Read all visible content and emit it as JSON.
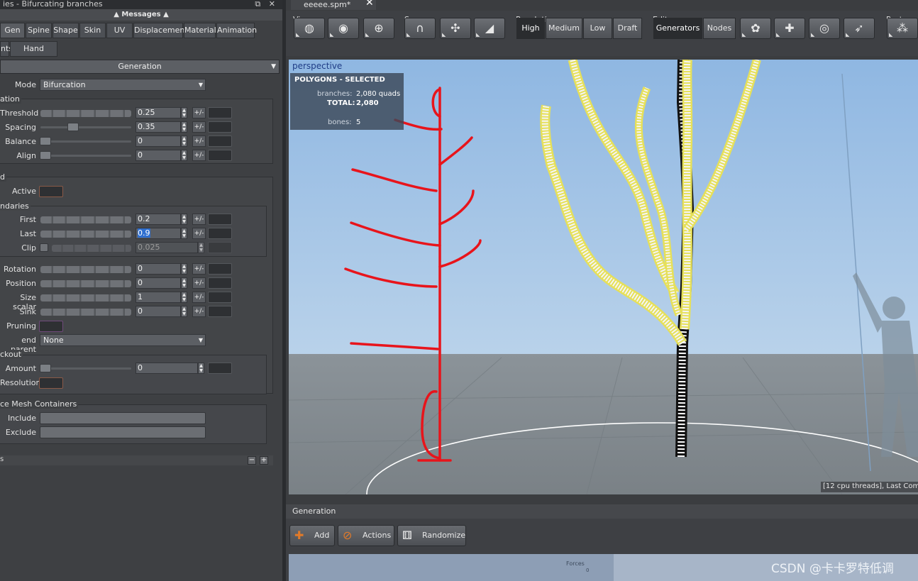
{
  "left_panel": {
    "title": "ies - Bifurcating branches",
    "title_buttons": "⧉ ✕",
    "messages": "▲ Messages ▲",
    "tabs": [
      "Gen",
      "Spine",
      "Shape",
      "Skin",
      "UV",
      "Displacement",
      "Material",
      "Animation"
    ],
    "tabs2": [
      "nts",
      "Hand Drawn"
    ],
    "section": "Generation",
    "mode_label": "Mode",
    "mode_value": "Bifurcation",
    "group1_label": "ation",
    "group2_label": "d",
    "group3_label": "ndaries",
    "group4_label": "ckout",
    "group5_label": "ce Mesh Containers",
    "rows": {
      "threshold": {
        "label": "Threshold",
        "value": "0.25"
      },
      "spacing": {
        "label": "Spacing",
        "value": "0.35",
        "level": 0.35
      },
      "balance": {
        "label": "Balance",
        "value": "0"
      },
      "align": {
        "label": "Align",
        "value": "0"
      },
      "active": {
        "label": "Active"
      },
      "first": {
        "label": "First",
        "value": "0.2"
      },
      "last": {
        "label": "Last",
        "value": "0.9"
      },
      "clip": {
        "label": "Clip",
        "value": "0.025"
      },
      "rotation": {
        "label": "Rotation",
        "value": "0"
      },
      "position": {
        "label": "Position",
        "value": "0"
      },
      "size_scalar": {
        "label": "Size scalar",
        "value": "1"
      },
      "sink": {
        "label": "Sink",
        "value": "0"
      },
      "pruning": {
        "label": "Pruning"
      },
      "end_parent": {
        "label": "end parent",
        "value": "None"
      },
      "amount": {
        "label": "Amount",
        "value": "0"
      },
      "resolution": {
        "label": "Resolution"
      },
      "include": {
        "label": "Include"
      },
      "exclude": {
        "label": "Exclude"
      }
    },
    "pm": "+/-",
    "bottom_label": "s",
    "bottom_minus": "−",
    "bottom_plus": "+"
  },
  "doc_tab": {
    "name": "eeeee.spm*",
    "close": "✕"
  },
  "toolbar": {
    "view_label": "View",
    "scene_label": "Scene",
    "resolution_label": "Resolution",
    "edit_label": "Edit",
    "post_label": "Post",
    "resolutions": [
      "High",
      "Medium",
      "Low",
      "Draft"
    ],
    "edit_modes": [
      "Generators",
      "Nodes"
    ]
  },
  "viewport": {
    "camera": "perspective",
    "stats_title": "POLYGONS - SELECTED",
    "branches_label": "branches:",
    "branches_value": "2,080 quads",
    "total_label": "TOTAL:",
    "total_value": "2,080",
    "bones_label": "bones:",
    "bones_value": "5",
    "status": "[12 cpu threads], Last Com"
  },
  "generation_panel": {
    "title": "Generation",
    "add": "Add",
    "actions": "Actions",
    "randomize": "Randomize",
    "forces": "Forces",
    "forces_count": "0"
  },
  "watermark": "CSDN @卡卡罗特低调",
  "colors": {
    "accent_blue": "#2f6fd0",
    "annotation_red": "#e8141b",
    "selection_yellow": "#e6e05a",
    "sky_top": "#8fb7e2"
  }
}
